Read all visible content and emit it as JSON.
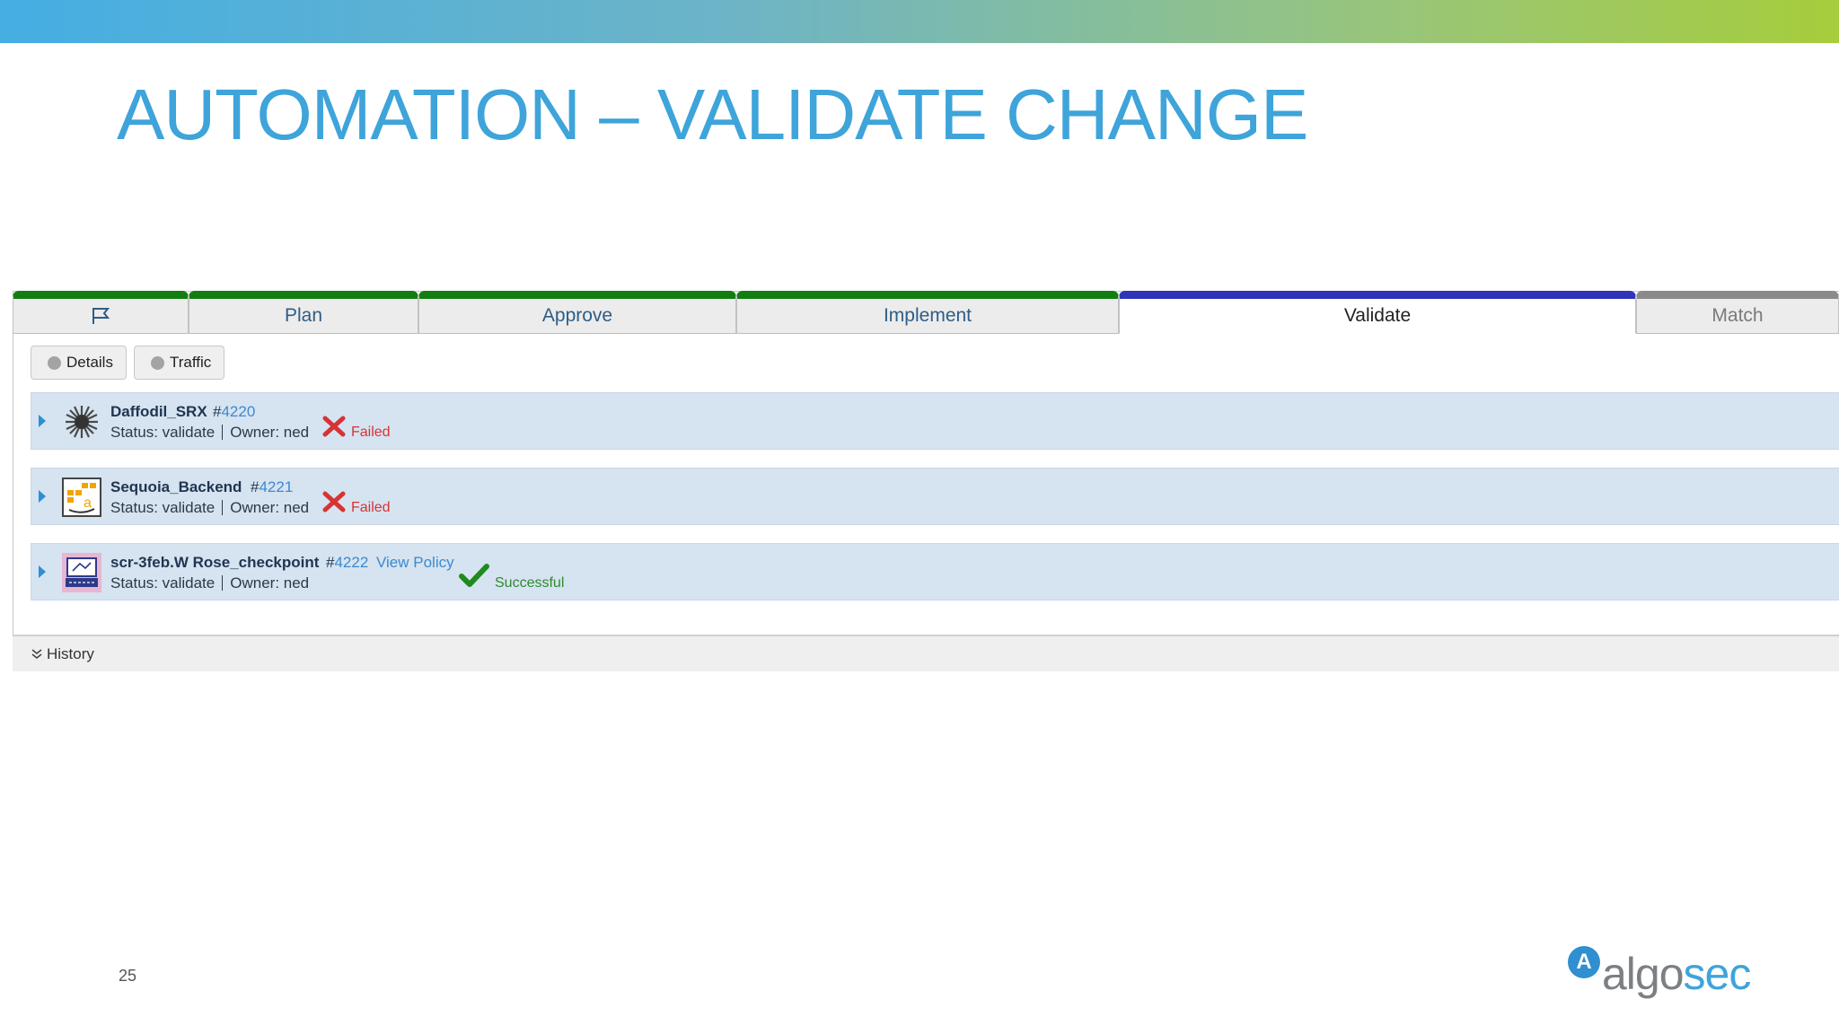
{
  "slide": {
    "title": "AUTOMATION – VALIDATE CHANGE",
    "page_number": "25",
    "logo": "algosec"
  },
  "tabs": [
    {
      "label": "",
      "icon": "flag-icon",
      "state": "done"
    },
    {
      "label": "Plan",
      "state": "done"
    },
    {
      "label": "Approve",
      "state": "done"
    },
    {
      "label": "Implement",
      "state": "done"
    },
    {
      "label": "Validate",
      "state": "active"
    },
    {
      "label": "Match",
      "state": "future"
    }
  ],
  "filters": [
    {
      "label": "Details",
      "icon": "radio-dot-icon"
    },
    {
      "label": "Traffic",
      "icon": "radio-dot-icon"
    }
  ],
  "devices": [
    {
      "name": "Daffodil_SRX",
      "hash": "#",
      "id": "4220",
      "status_label": "Status: validate",
      "owner_label": "Owner: ned",
      "result": "Failed",
      "result_icon": "cross-icon",
      "device_icon": "juniper-device-icon"
    },
    {
      "name": "Sequoia_Backend",
      "hash": "#",
      "id": "4221",
      "status_label": "Status: validate",
      "owner_label": "Owner: ned",
      "result": "Failed",
      "result_icon": "cross-icon",
      "device_icon": "aws-device-icon"
    },
    {
      "name": "scr-3feb.W Rose_checkpoint",
      "hash": "#",
      "id": "4222",
      "link": "View Policy",
      "status_label": "Status: validate",
      "owner_label": "Owner: ned",
      "result": "Successful",
      "result_icon": "checkmark-icon",
      "device_icon": "checkpoint-device-icon"
    }
  ],
  "history": {
    "label": "History",
    "icon": "double-chevron-down-icon"
  },
  "colors": {
    "title": "#3ea4da",
    "tab_done": "#127e12",
    "tab_active": "#3034b8",
    "tab_future": "#8a8a8a",
    "row_bg": "#d6e3f0",
    "failed": "#d63434",
    "success": "#2e8b2e",
    "link": "#3a8ad0"
  }
}
